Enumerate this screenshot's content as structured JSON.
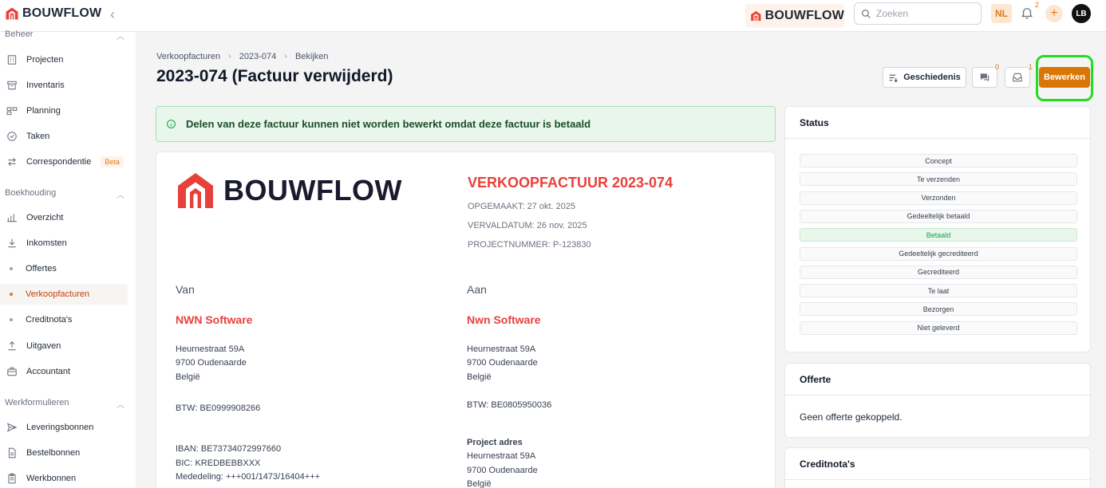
{
  "app": {
    "brand": "BOUWFLOW"
  },
  "topbar": {
    "search_placeholder": "Zoeken",
    "language": "NL",
    "notifications_count": "2",
    "user_initials": "LB"
  },
  "sidebar": {
    "sections": [
      {
        "title": "Beheer"
      },
      {
        "title": "Boekhouding"
      },
      {
        "title": "Werkformulieren"
      }
    ],
    "items": [
      {
        "label": "Projecten",
        "icon": "building-icon"
      },
      {
        "label": "Inventaris",
        "icon": "archive-icon"
      },
      {
        "label": "Planning",
        "icon": "planning-icon"
      },
      {
        "label": "Taken",
        "icon": "check-circle-icon"
      },
      {
        "label": "Correspondentie",
        "icon": "arrows-icon",
        "badge": "Beta"
      },
      {
        "label": "Overzicht",
        "icon": "bar-chart-icon"
      },
      {
        "label": "Inkomsten",
        "icon": "download-icon"
      },
      {
        "label": "Offertes"
      },
      {
        "label": "Verkoopfacturen",
        "active": true
      },
      {
        "label": "Creditnota's"
      },
      {
        "label": "Uitgaven",
        "icon": "upload-icon"
      },
      {
        "label": "Accountant",
        "icon": "briefcase-icon"
      },
      {
        "label": "Leveringsbonnen",
        "icon": "send-icon"
      },
      {
        "label": "Bestelbonnen",
        "icon": "document-icon"
      },
      {
        "label": "Werkbonnen",
        "icon": "clipboard-icon"
      }
    ]
  },
  "breadcrumb": [
    "Verkoopfacturen",
    "2023-074",
    "Bekijken"
  ],
  "page": {
    "title": "2023-074 (Factuur verwijderd)"
  },
  "actions": {
    "history_label": "Geschiedenis",
    "comments_count": "0",
    "inbox_count": "1",
    "edit_label": "Bewerken"
  },
  "alert": {
    "text": "Delen van deze factuur kunnen niet worden bewerkt omdat deze factuur is betaald"
  },
  "invoice": {
    "title": "VERKOOPFACTUUR 2023-074",
    "created": "OPGEMAAKT: 27 okt. 2025",
    "due": "VERVALDATUM: 26 nov. 2025",
    "project": "PROJECTNUMMER: P-123830",
    "from": {
      "heading": "Van",
      "name": "NWN Software",
      "street": "Heurnestraat 59A",
      "city": "9700 Oudenaarde",
      "country": "België",
      "vat": "BTW: BE0999908266",
      "iban": "IBAN: BE73734072997660",
      "bic": "BIC: KREDBEBBXXX",
      "reference": "Mededeling: +++001/1473/16404+++"
    },
    "to": {
      "heading": "Aan",
      "name": "Nwn Software",
      "street": "Heurnestraat 59A",
      "city": "9700 Oudenaarde",
      "country": "België",
      "vat": "BTW: BE0805950036",
      "project_address_label": "Project adres",
      "project_street": "Heurnestraat 59A",
      "project_city": "9700 Oudenaarde",
      "project_country": "België"
    }
  },
  "status_panel": {
    "title": "Status",
    "items": [
      "Concept",
      "Te verzenden",
      "Verzonden",
      "Gedeeltelijk betaald",
      "Betaald",
      "Gedeeltelijk gecrediteerd",
      "Gecrediteerd",
      "Te laat",
      "Bezorgen",
      "Niet geleverd"
    ],
    "active": "Betaald"
  },
  "offerte_panel": {
    "title": "Offerte",
    "body": "Geen offerte gekoppeld."
  },
  "creditnota_panel": {
    "title": "Creditnota's"
  },
  "colors": {
    "accent": "#d97706",
    "brand_red": "#e8413b",
    "success": "#16a34a"
  }
}
